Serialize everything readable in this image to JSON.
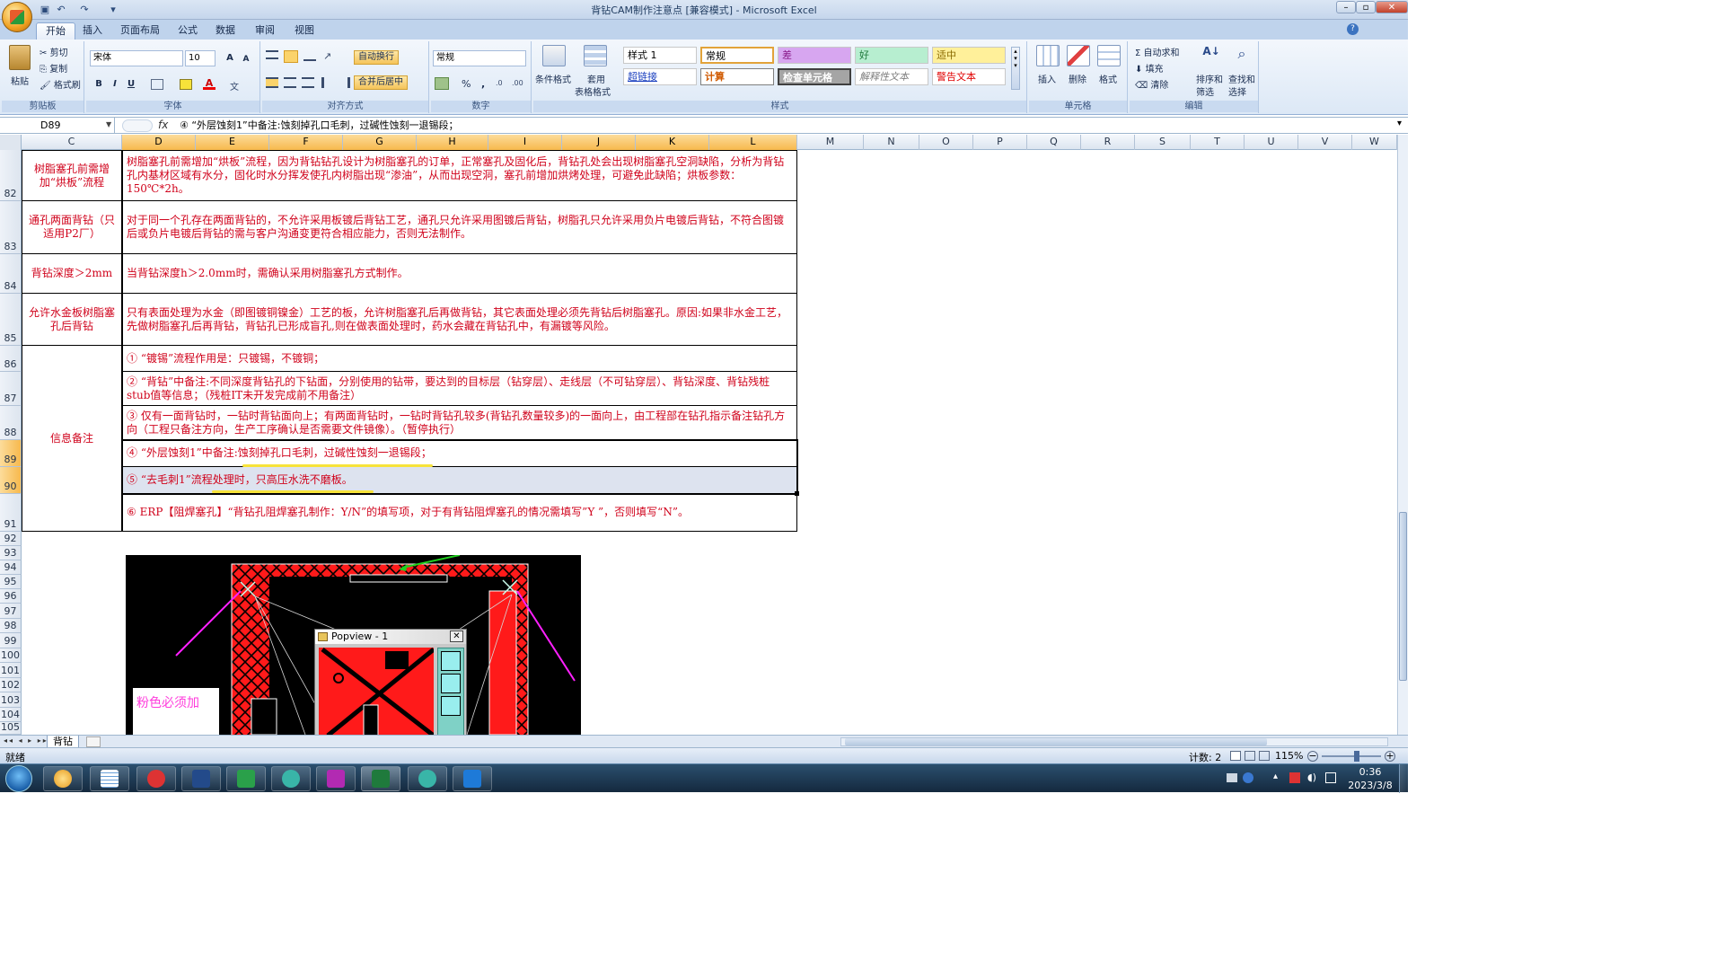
{
  "window": {
    "title": "背钻CAM制作注意点 [兼容模式] - Microsoft Excel",
    "min": "–",
    "restore": "▫",
    "close": "✕"
  },
  "ribbon": {
    "tabs": [
      "开始",
      "插入",
      "页面布局",
      "公式",
      "数据",
      "审阅",
      "视图"
    ],
    "clipboard": {
      "paste": "粘贴",
      "cut": "剪切",
      "copy": "复制",
      "format_painter": "格式刷",
      "label": "剪贴板"
    },
    "font": {
      "name": "宋体",
      "size": "10",
      "label": "字体",
      "bold": "B",
      "italic": "I",
      "underline": "U",
      "grow": "A",
      "shrink": "A"
    },
    "alignment": {
      "wrap": "自动换行",
      "merge": "合并后居中",
      "label": "对齐方式"
    },
    "number": {
      "format": "常规",
      "label": "数字",
      "percent": "%",
      "comma": ","
    },
    "styles": {
      "conditional": "条件格式",
      "table": "套用",
      "table2": "表格格式",
      "label": "样式",
      "cells": [
        [
          "样式 1",
          "常规",
          "差",
          "好",
          "适中"
        ],
        [
          "超链接",
          "计算",
          "检查单元格",
          "解释性文本",
          "警告文本"
        ]
      ]
    },
    "cells": {
      "insert": "插入",
      "delete": "删除",
      "format": "格式",
      "label": "单元格"
    },
    "editing": {
      "autosum": "自动求和",
      "fill": "填充",
      "clear": "清除",
      "sort": "排序和",
      "sort2": "筛选",
      "find": "查找和",
      "find2": "选择",
      "label": "编辑"
    }
  },
  "formula_bar": {
    "name_box": "D89",
    "fx": "fx",
    "formula": "④ “外层蚀刻1”中备注:蚀刻掉孔口毛刺，过碱性蚀刻一退锡段；"
  },
  "columns": [
    "C",
    "D",
    "E",
    "F",
    "G",
    "H",
    "I",
    "J",
    "K",
    "L",
    "M",
    "N",
    "O",
    "P",
    "Q",
    "R",
    "S",
    "T",
    "U",
    "V",
    "W"
  ],
  "rows": {
    "r82": {
      "num": "82",
      "c": "树脂塞孔前需增加“烘板”流程",
      "d": "树脂塞孔前需增加“烘板”流程，因为背钻钻孔设计为树脂塞孔的订单，正常塞孔及固化后，背钻孔处会出现树脂塞孔空洞缺陷，分析为背钻孔内基材区域有水分，固化时水分挥发使孔内树脂出现“渗油”，从而出现空洞，塞孔前增加烘烤处理，可避免此缺陷；烘板参数：150℃*2h。"
    },
    "r83": {
      "num": "83",
      "c": "通孔两面背钻（只适用P2厂）",
      "d": "对于同一个孔存在两面背钻的，不允许采用板镀后背钻工艺，通孔只允许采用图镀后背钻，树脂孔只允许采用负片电镀后背钻，不符合图镀后或负片电镀后背钻的需与客户沟通变更符合相应能力，否则无法制作。"
    },
    "r84": {
      "num": "84",
      "c": "背钻深度＞2mm",
      "d": "当背钻深度h＞2.0mm时，需确认采用树脂塞孔方式制作。"
    },
    "r85": {
      "num": "85",
      "c": "允许水金板树脂塞孔后背钻",
      "d": "只有表面处理为水金（即图镀铜镍金）工艺的板，允许树脂塞孔后再做背钻，其它表面处理必须先背钻后树脂塞孔。原因:如果非水金工艺，先做树脂塞孔后再背钻，背钻孔已形成盲孔,则在做表面处理时，药水会藏在背钻孔中，有漏镀等风险。"
    },
    "merged_c": "信息备注",
    "r86": {
      "num": "86",
      "d": "① “镀锡”流程作用是：只镀锡，不镀铜；"
    },
    "r87": {
      "num": "87",
      "d": "② “背钻”中备注:不同深度背钻孔的下钻面，分别使用的钻带，要达到的目标层（钻穿层）、走线层（不可钻穿层）、背钻深度、背钻残桩stub值等信息；（残桩IT未开发完成前不用备注）"
    },
    "r88": {
      "num": "88",
      "d": "③ 仅有一面背钻时，一钻时背钻面向上；有两面背钻时，一钻时背钻孔较多(背钻孔数量较多)的一面向上，由工程部在钻孔指示备注钻孔方向（工程只备注方向，生产工序确认是否需要文件镜像）。（暂停执行）"
    },
    "r89": {
      "num": "89",
      "d": "④ “外层蚀刻1”中备注:蚀刻掉孔口毛刺，过碱性蚀刻一退锡段；"
    },
    "r90": {
      "num": "90",
      "d": "⑤ “去毛刺1”流程处理时，只高压水洗不磨板。"
    },
    "r91": {
      "num": "91",
      "d": "⑥ ERP【阻焊塞孔】“背钻孔阻焊塞孔制作：Y/N”的填写项，对于有背钻阻焊塞孔的情况需填写”Y ”，否则填写“N”。"
    },
    "empty": [
      "92",
      "93",
      "94",
      "95",
      "96",
      "97",
      "98",
      "99",
      "100",
      "101",
      "102",
      "103",
      "104",
      "105"
    ]
  },
  "picture": {
    "popview_title": "Popview - 1",
    "note": "粉色必须加",
    "close": "✕"
  },
  "sheet_tab": "背钻",
  "status": {
    "ready": "就绪",
    "count": "计数: 2",
    "zoom": "115%"
  },
  "taskbar": {
    "time": "0:36",
    "date": "2023/3/8"
  },
  "colors": {
    "accent": "#f7b94d",
    "text_red": "#d0021b",
    "ribbon": "#dce8f6"
  }
}
